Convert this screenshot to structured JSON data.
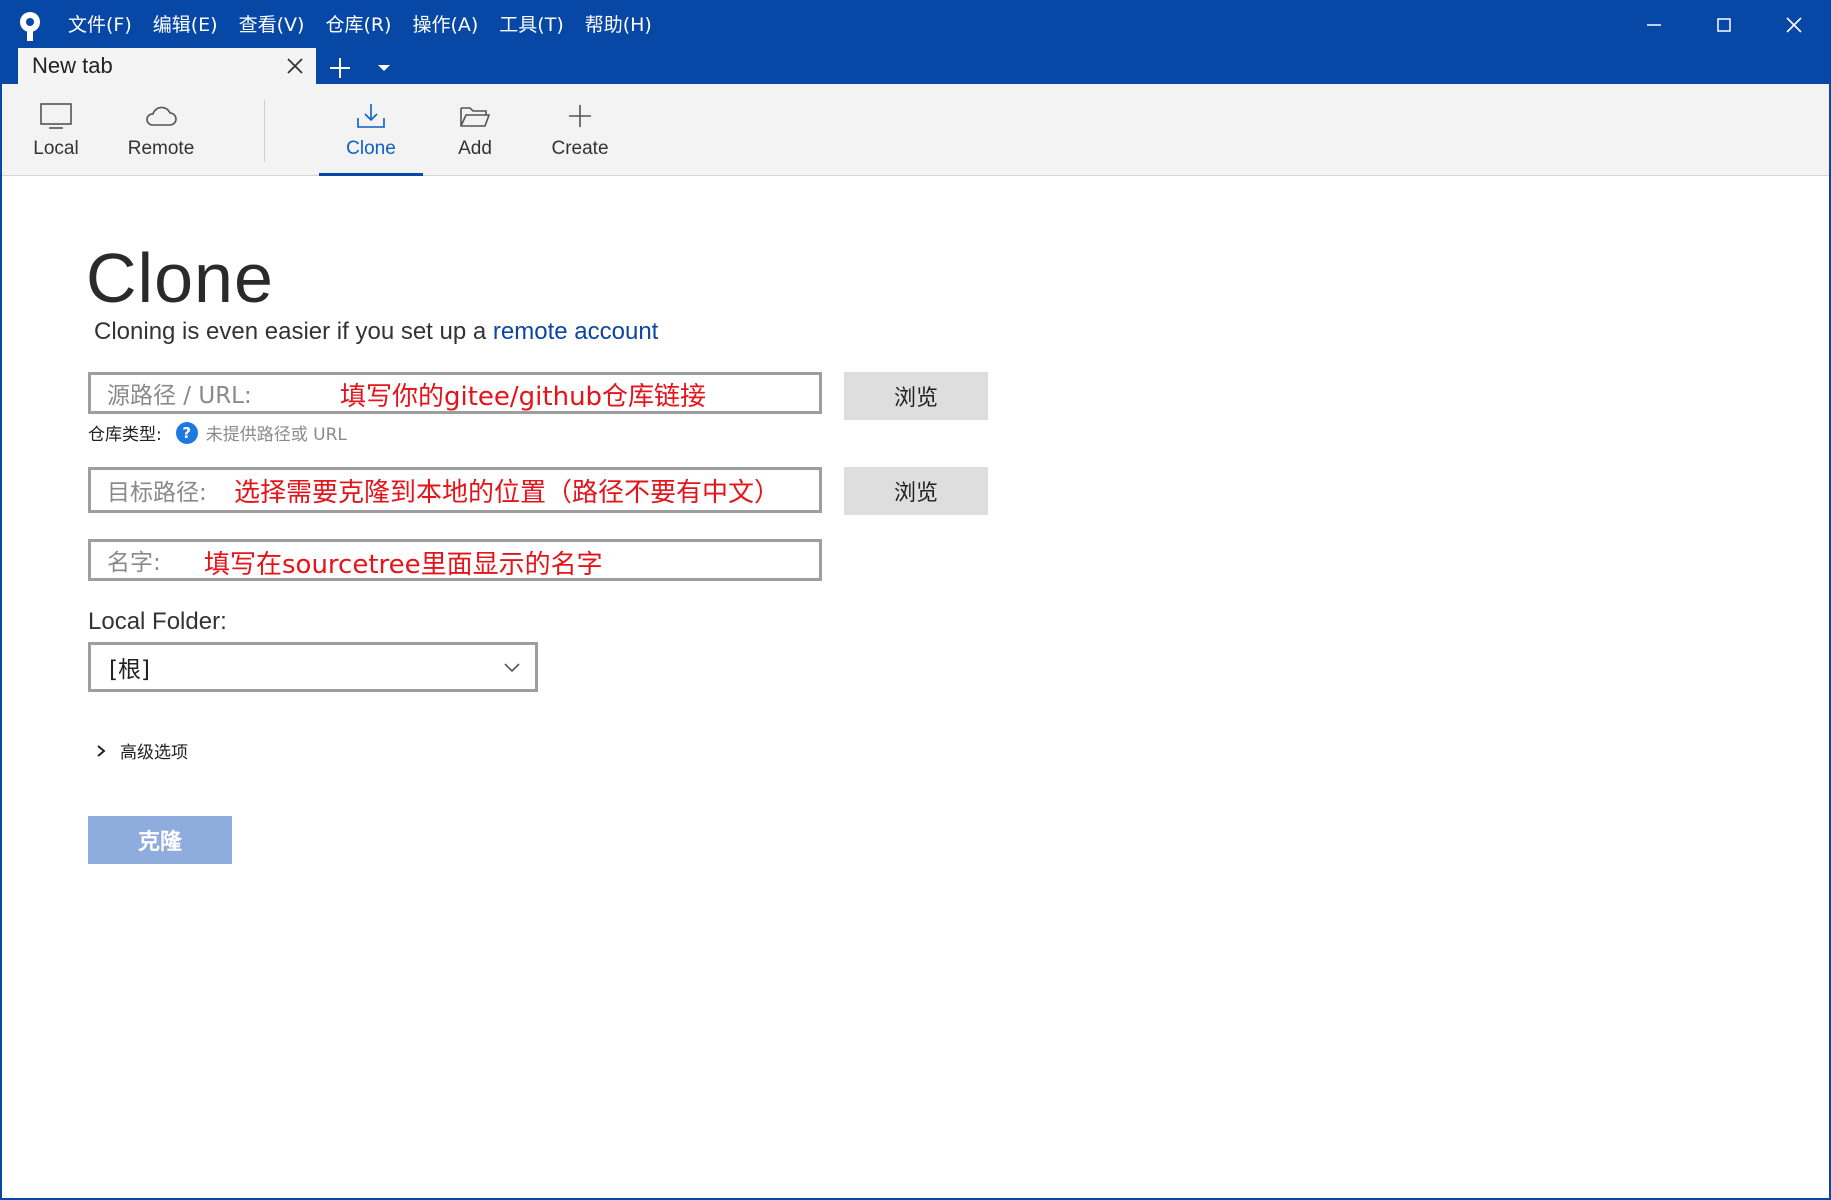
{
  "menu": {
    "items": [
      "文件(F)",
      "编辑(E)",
      "查看(V)",
      "仓库(R)",
      "操作(A)",
      "工具(T)",
      "帮助(H)"
    ]
  },
  "tab": {
    "title": "New tab"
  },
  "toolbar": {
    "local": "Local",
    "remote": "Remote",
    "clone": "Clone",
    "add": "Add",
    "create": "Create"
  },
  "clone": {
    "title": "Clone",
    "subtitle": "Cloning is even easier if you set up a",
    "subtitle_link": "remote account",
    "source_label": "源路径 / URL:",
    "source_note": "填写你的gitee/github仓库链接",
    "browse1": "浏览",
    "repo_type_label": "仓库类型:",
    "repo_type_status": "未提供路径或 URL",
    "target_label": "目标路径:",
    "target_note": "选择需要克隆到本地的位置（路径不要有中文）",
    "browse2": "浏览",
    "name_label": "名字:",
    "name_note": "填写在sourcetree里面显示的名字",
    "local_folder_label": "Local Folder:",
    "local_folder_value": "[根]",
    "advanced_label": "高级选项",
    "clone_button": "克隆"
  },
  "colors": {
    "titlebar": "#0747a6",
    "accent": "#0b61c8",
    "note": "#e5141b",
    "disabled_button": "#8eadde"
  }
}
